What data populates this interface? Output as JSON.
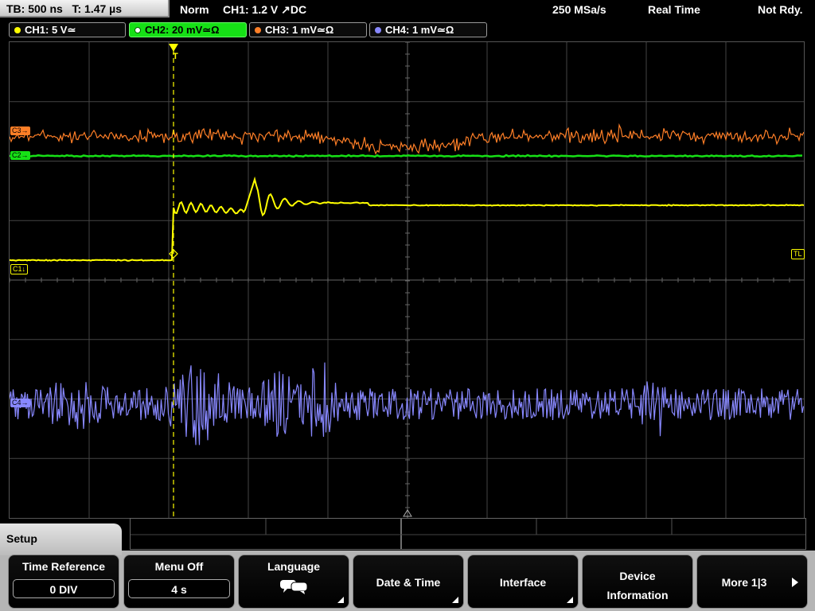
{
  "topbar": {
    "tb": "TB: 500 ns",
    "t": "T: 1.47 µs",
    "trigger_mode": "Norm",
    "trigger_info": "CH1: 1.2 V ↗DC",
    "sample_rate": "250 MSa/s",
    "acq_mode": "Real Time",
    "status": "Not Rdy."
  },
  "channels": [
    {
      "label": "CH1: 5 V≃",
      "color": "#ffff00"
    },
    {
      "label": "CH2: 20 mV≃Ω",
      "color": "#16e016"
    },
    {
      "label": "CH3: 1 mV≃Ω",
      "color": "#ff7f27"
    },
    {
      "label": "CH4: 1 mV≃Ω",
      "color": "#8888ff"
    }
  ],
  "markers": {
    "c1": "C1↓",
    "c2": "C2→",
    "c3": "C3→",
    "c4": "C4→",
    "tl": "TL",
    "trigger_point": "T"
  },
  "menu": {
    "title": "Setup",
    "softkeys": [
      {
        "title": "Time Reference",
        "value": "0 DIV"
      },
      {
        "title": "Menu Off",
        "value": "4 s"
      },
      {
        "title": "Language",
        "icon": "speech-bubble-icon"
      },
      {
        "title": "Date & Time"
      },
      {
        "title": "Interface"
      },
      {
        "title_line1": "Device",
        "title_line2": "Information"
      },
      {
        "title": "More 1|3",
        "icon": "arrow-right-icon"
      }
    ]
  }
}
